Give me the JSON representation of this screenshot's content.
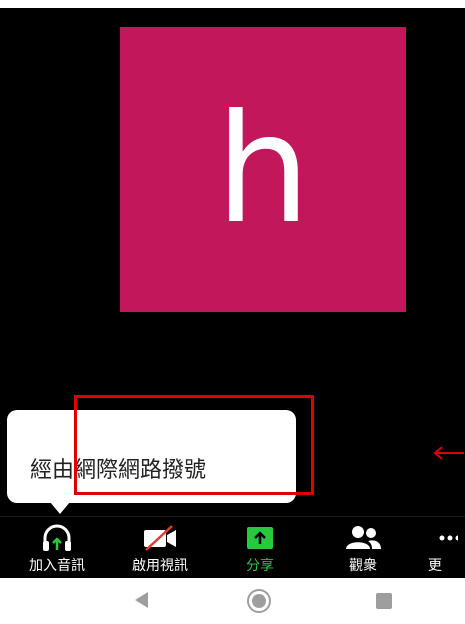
{
  "participant": {
    "initial": "h",
    "tile_color": "#c2185b"
  },
  "tooltip": {
    "text": "經由網際網路撥號"
  },
  "toolbar": {
    "audio_label": "加入音訊",
    "video_label": "啟用視訊",
    "share_label": "分享",
    "participants_label": "觀衆",
    "more_label": "更"
  },
  "colors": {
    "accent_green": "#27c93f",
    "highlight_red": "#e00000"
  },
  "icons": [
    "headphones-icon",
    "video-off-icon",
    "share-arrow-icon",
    "participants-icon",
    "more-icon",
    "back-icon",
    "home-icon",
    "recents-icon"
  ]
}
